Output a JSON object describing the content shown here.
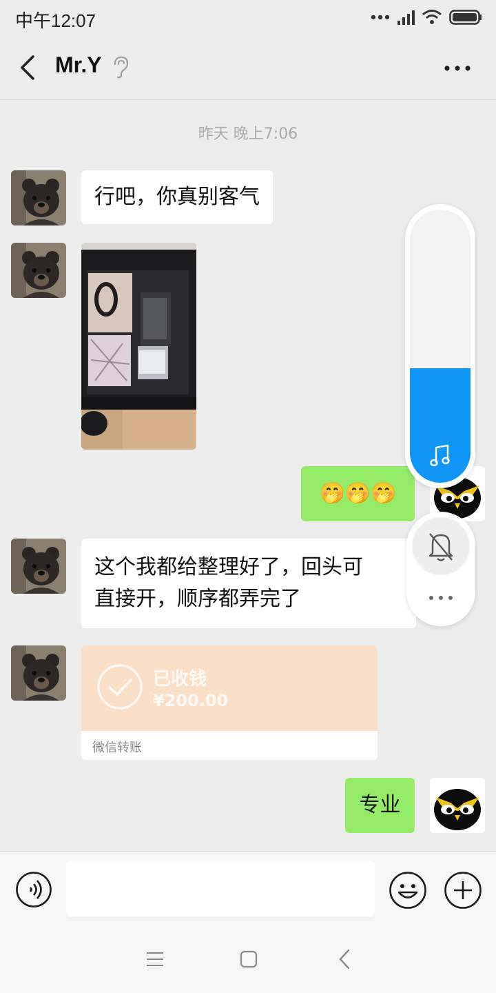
{
  "status_bar": {
    "time": "中午12:07"
  },
  "header": {
    "title": "Mr.Y"
  },
  "chat": {
    "timestamp": "昨天 晚上7:06",
    "messages": [
      {
        "sender": "Mr.Y",
        "type": "text",
        "text": "行吧，你真别客气"
      },
      {
        "sender": "Mr.Y",
        "type": "image"
      },
      {
        "sender": "me",
        "type": "emoji",
        "text": "🤭🤭🤭"
      },
      {
        "sender": "Mr.Y",
        "type": "text",
        "lines": [
          "这个我都给整理好了，回头可",
          "直接开，顺序都弄完了"
        ]
      },
      {
        "sender": "Mr.Y",
        "type": "transfer",
        "status": "已收钱",
        "amount": "¥200.00",
        "footer": "微信转账"
      },
      {
        "sender": "me",
        "type": "text",
        "text": "专业"
      }
    ]
  },
  "volume_overlay": {
    "level": 0.42,
    "accent": "#1096f7",
    "icons": [
      "music-note-icon",
      "bell-off-icon",
      "more-dots-icon"
    ]
  },
  "colors": {
    "sent_bubble": "#95ec69",
    "received_bubble": "#ffffff",
    "transfer_card": "#fbe0c7",
    "background": "#ededed"
  }
}
